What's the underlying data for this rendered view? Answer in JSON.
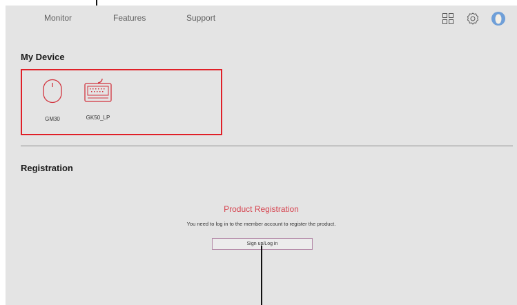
{
  "nav": {
    "items": [
      "Monitor",
      "Features",
      "Support"
    ],
    "icons": [
      "grid-icon",
      "settings-icon",
      "user-avatar"
    ]
  },
  "my_device": {
    "title": "My Device",
    "devices": [
      {
        "label": "GM30",
        "icon": "mouse-icon"
      },
      {
        "label": "GK50_LP",
        "icon": "keyboard-icon"
      }
    ]
  },
  "registration": {
    "title": "Registration",
    "heading": "Product Registration",
    "description": "You need to log in to the member account to register the product.",
    "button_label": "Sign up/Log in"
  },
  "colors": {
    "accent": "#e02028",
    "heading_red": "#d64550",
    "background": "#e4e4e4"
  }
}
